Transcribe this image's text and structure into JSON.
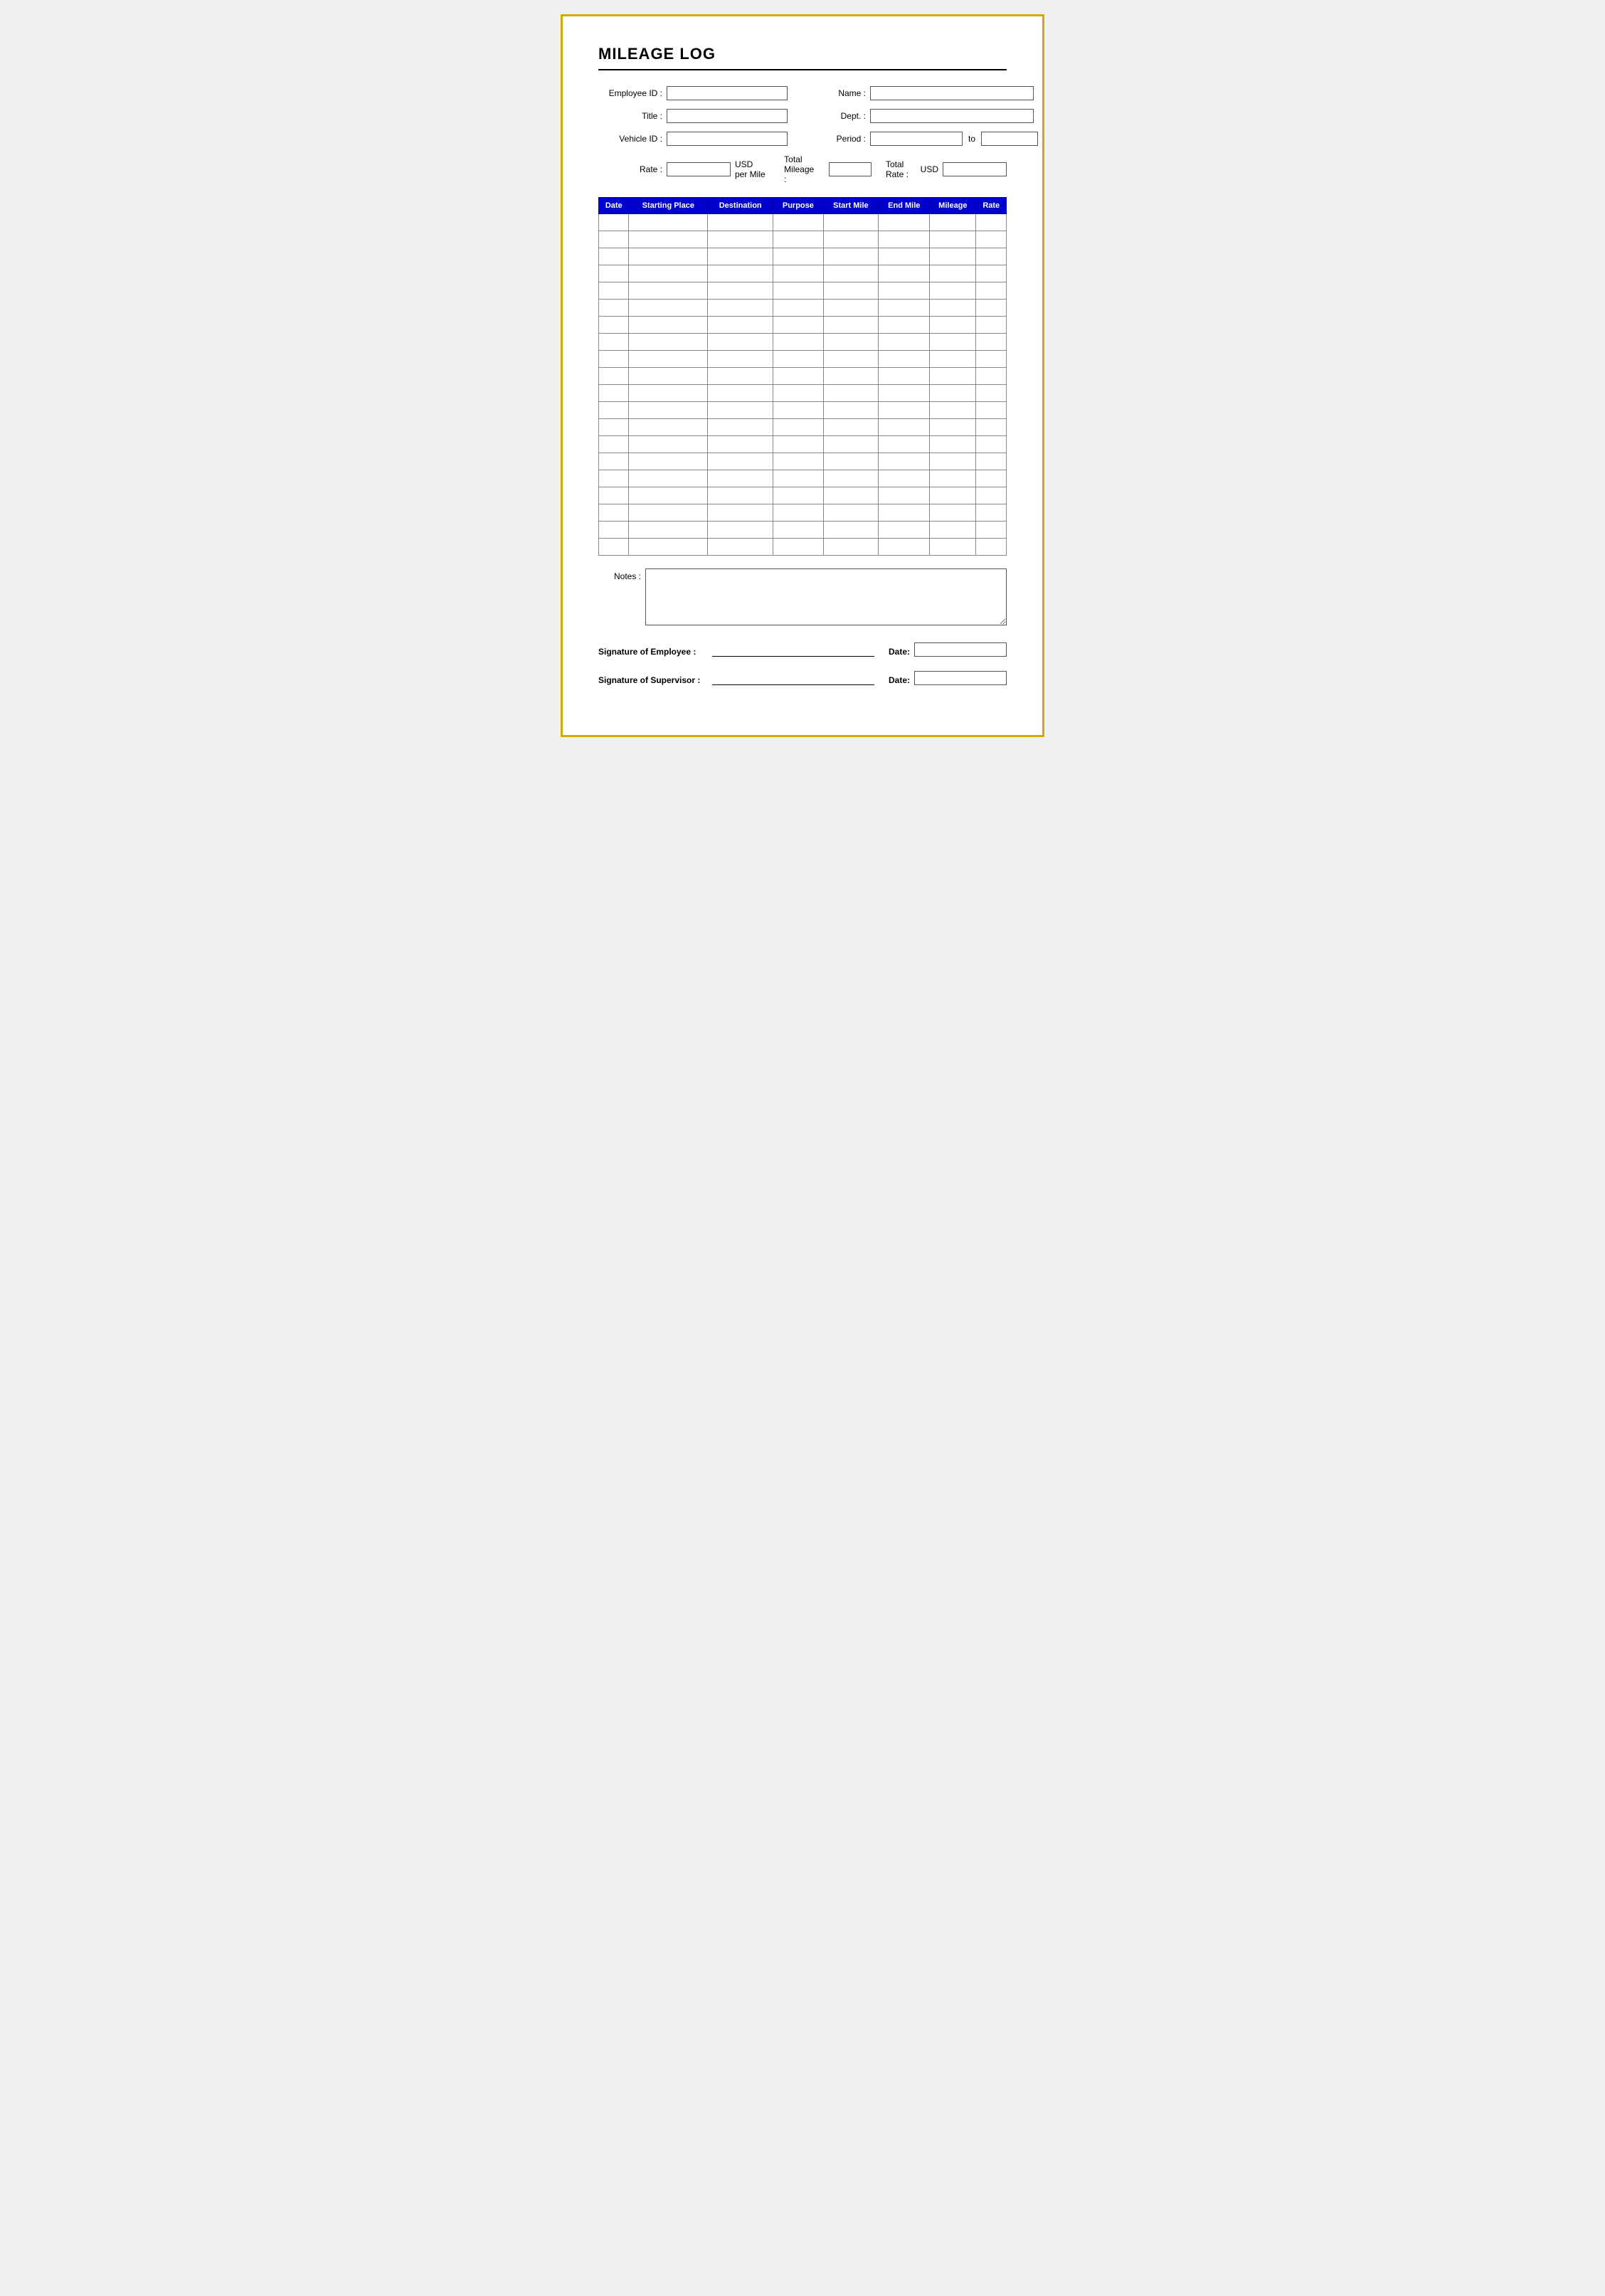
{
  "title": "MILEAGE LOG",
  "form": {
    "employee_id_label": "Employee ID :",
    "name_label": "Name :",
    "title_label": "Title :",
    "dept_label": "Dept. :",
    "vehicle_id_label": "Vehicle ID :",
    "period_label": "Period :",
    "to_label": "to",
    "rate_label": "Rate :",
    "usd_per_mile_label": "USD per Mile",
    "total_mileage_label": "Total Mileage :",
    "total_rate_label": "Total Rate :",
    "usd_label": "USD"
  },
  "table": {
    "headers": [
      "Date",
      "Starting Place",
      "Destination",
      "Purpose",
      "Start Mile",
      "End Mile",
      "Mileage",
      "Rate"
    ],
    "row_count": 20
  },
  "notes": {
    "label": "Notes :"
  },
  "signatures": {
    "employee_label": "Signature of Employee :",
    "supervisor_label": "Signature of Supervisor :",
    "date_label": "Date:"
  }
}
